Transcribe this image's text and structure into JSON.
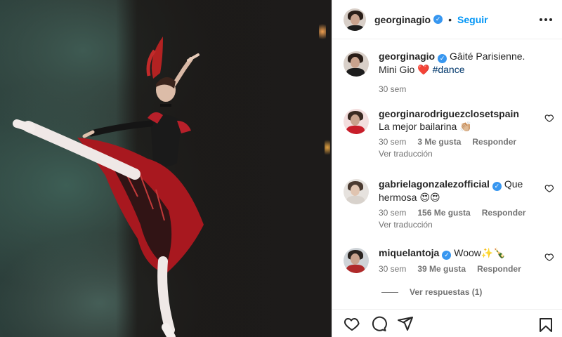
{
  "post": {
    "author": "georginagio",
    "follow_label": "Seguir",
    "separator": "•"
  },
  "caption": {
    "username": "georginagio",
    "text_before_tag": "Gâité Parisienne. Mini Gio ❤️ ",
    "hashtag": "#dance",
    "time": "30 sem"
  },
  "comments": [
    {
      "username": "georginarodriguezclosetspain",
      "text": "La mejor bailarina 👏🏼",
      "time": "30 sem",
      "likes": "3 Me gusta",
      "reply_label": "Responder",
      "translate_label": "Ver traducción",
      "verified": false
    },
    {
      "username": "gabrielagonzalezofficial",
      "text": "Que hermosa 😍😍",
      "time": "30 sem",
      "likes": "156 Me gusta",
      "reply_label": "Responder",
      "translate_label": "Ver traducción",
      "verified": true
    },
    {
      "username": "miquelantoja",
      "text": "Woow✨🍾",
      "time": "30 sem",
      "likes": "39 Me gusta",
      "reply_label": "Responder",
      "verified": true
    }
  ],
  "view_replies_label": "Ver respuestas (1)",
  "icons": {
    "like": "heart-icon",
    "comment": "comment-icon",
    "share": "send-icon",
    "save": "bookmark-icon",
    "more": "more-options-icon",
    "verified": "verified-badge-icon"
  },
  "colors": {
    "accent": "#0095f6",
    "verified": "#3897f0",
    "text": "#262626",
    "muted": "#737373",
    "border": "#efefef"
  }
}
